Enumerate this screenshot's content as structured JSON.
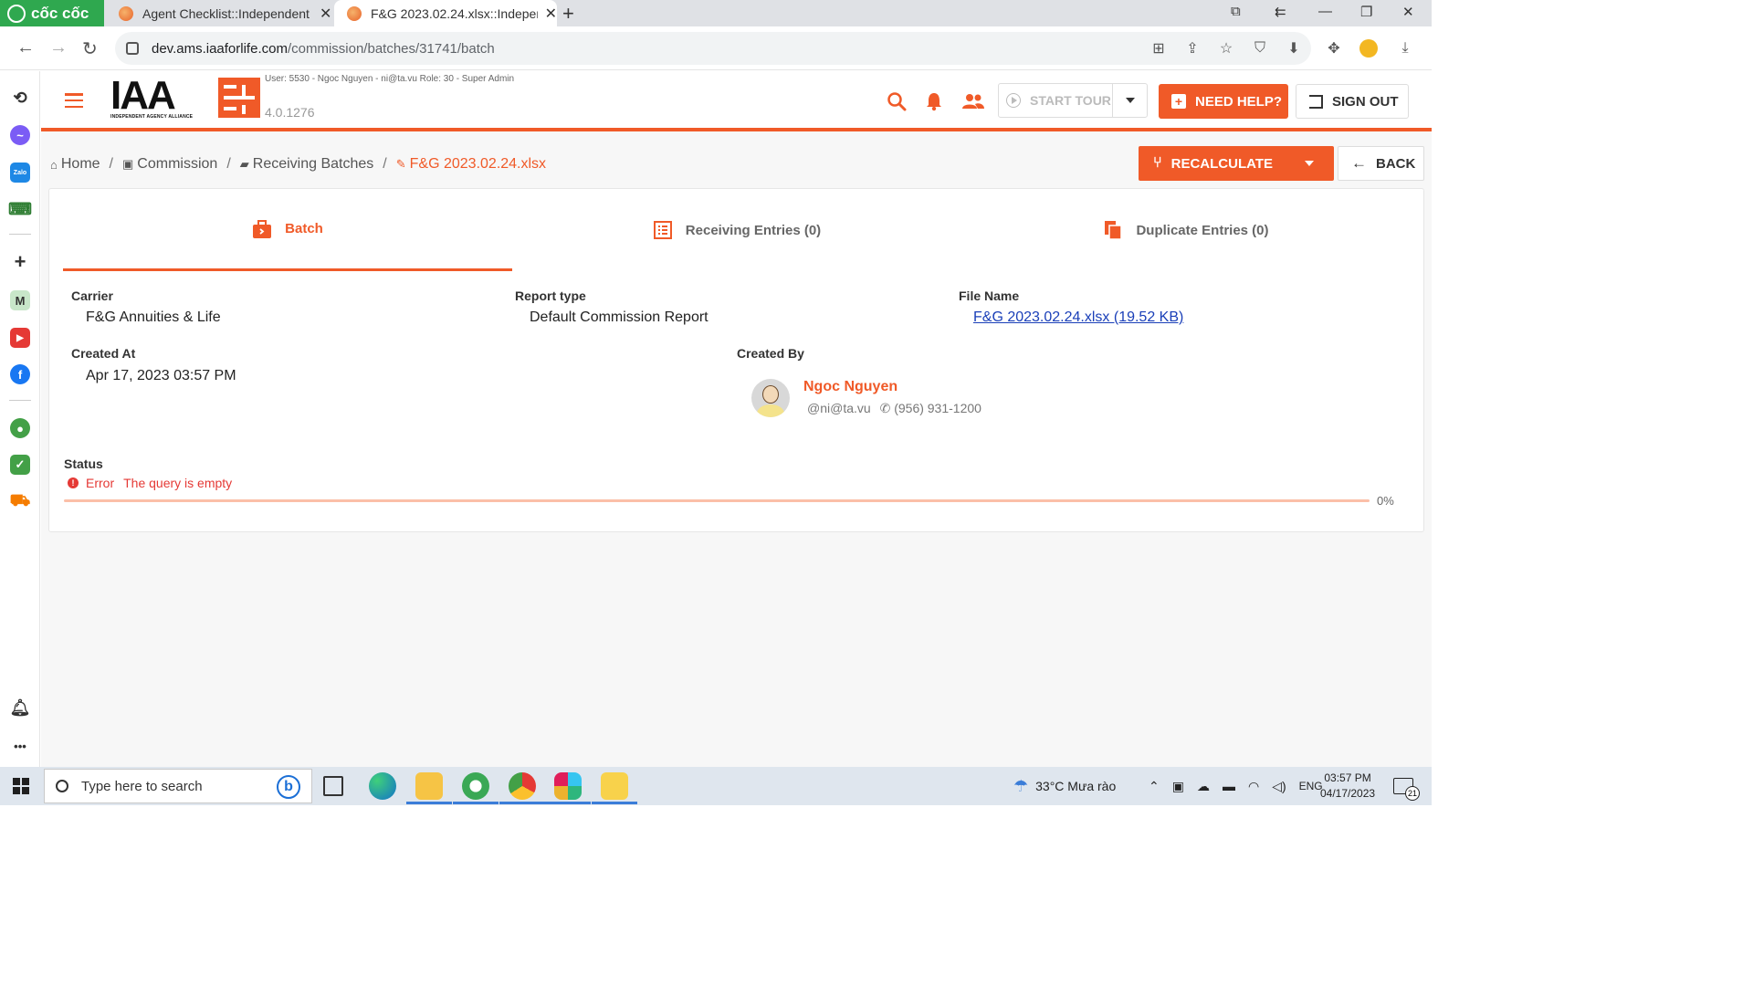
{
  "browser": {
    "brand": "cốc cốc",
    "tabs": [
      {
        "title": "Agent Checklist::Independent"
      },
      {
        "title": "F&G 2023.02.24.xlsx::Indepen"
      }
    ],
    "url_host": "dev.ams.iaaforlife.com",
    "url_path": "/commission/batches/31741/batch"
  },
  "header": {
    "logo_text": "IAA",
    "logo_sub": "INDEPENDENT AGENCY ALLIANCE",
    "user_line": "User: 5530 - Ngoc Nguyen - ni@ta.vu    Role: 30 - Super Admin",
    "version": "4.0.1276",
    "start_tour": "START TOUR",
    "need_help": "NEED HELP?",
    "sign_out": "SIGN OUT",
    "accent": "#f05a28"
  },
  "breadcrumb": {
    "home": "Home",
    "commission": "Commission",
    "receiving": "Receiving Batches",
    "current": "F&G 2023.02.24.xlsx"
  },
  "actions": {
    "recalculate": "RECALCULATE",
    "back": "BACK"
  },
  "tabs": [
    {
      "label": "Batch",
      "icon": "briefcase-icon"
    },
    {
      "label": "Receiving Entries (0)",
      "icon": "list-icon"
    },
    {
      "label": "Duplicate Entries (0)",
      "icon": "copy-icon"
    }
  ],
  "batch": {
    "carrier_label": "Carrier",
    "carrier": "F&G Annuities & Life",
    "report_type_label": "Report type",
    "report_type": "Default Commission Report",
    "file_name_label": "File Name",
    "file_name": "F&G 2023.02.24.xlsx (19.52 KB)",
    "created_at_label": "Created At",
    "created_at": "Apr 17, 2023 03:57 PM",
    "created_by_label": "Created By",
    "created_by_name": "Ngoc Nguyen",
    "created_by_email": "ni@ta.vu",
    "created_by_phone": "(956) 931-1200",
    "status_label": "Status",
    "status_word": "Error",
    "status_message": "The query is empty",
    "progress_percent": 0,
    "progress_text": "0%"
  },
  "taskbar": {
    "search_placeholder": "Type here to search",
    "weather": "33°C  Mưa rào",
    "language": "ENG",
    "time": "03:57 PM",
    "date": "04/17/2023",
    "notifications": "21"
  }
}
